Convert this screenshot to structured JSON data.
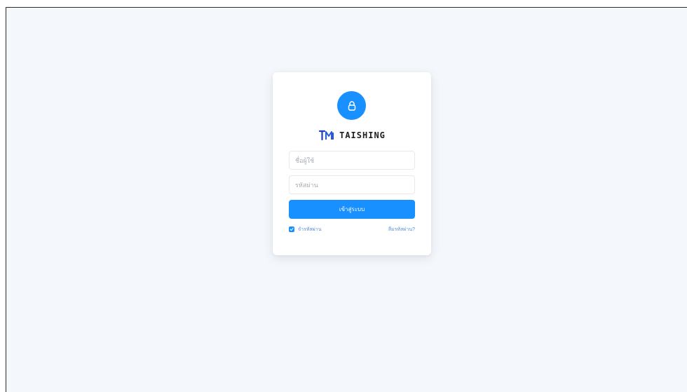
{
  "brand": {
    "name": "TAISHING"
  },
  "form": {
    "username_placeholder": "ชื่อผู้ใช้",
    "password_placeholder": "รหัสผ่าน",
    "login_label": "เข้าสู่ระบบ",
    "remember_label": "จำรหัสผ่าน",
    "remember_checked": true,
    "forgot_label": "ลืมรหัสผ่าน?"
  },
  "colors": {
    "accent": "#1890ff",
    "background": "#f4f7fb",
    "card": "#ffffff"
  },
  "icons": {
    "avatar": "lock-icon",
    "remember": "check-icon"
  }
}
